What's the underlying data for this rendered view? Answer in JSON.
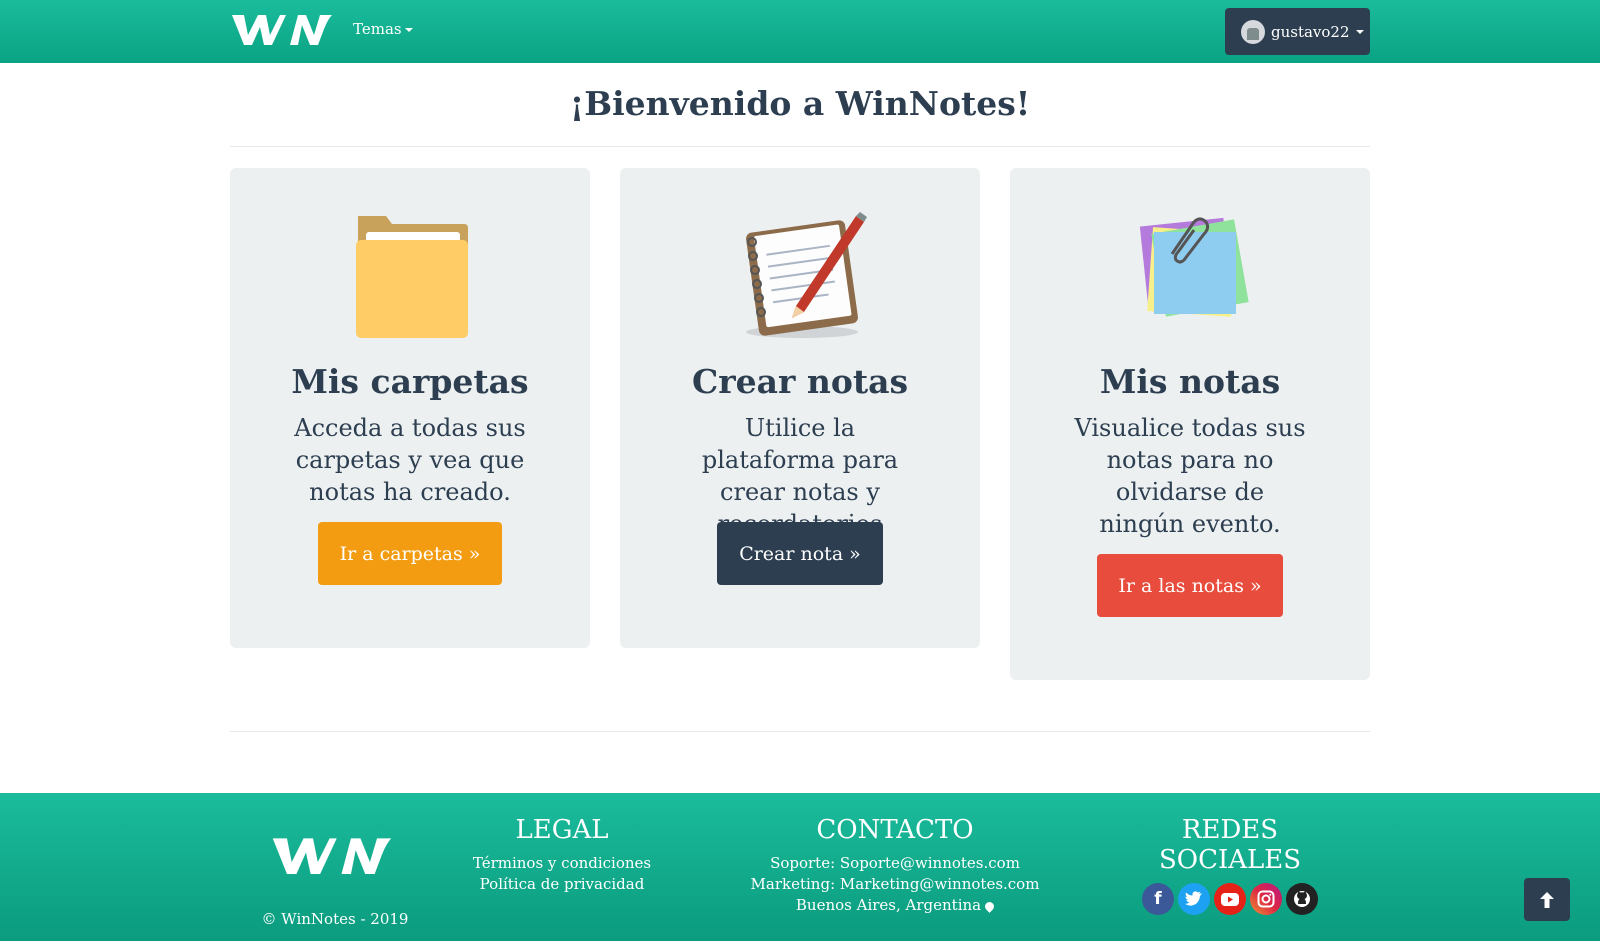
{
  "navbar": {
    "brand": "WN",
    "menu_temas": "Temas",
    "user_name": "gustavo22"
  },
  "page": {
    "title": "¡Bienvenido a WinNotes!"
  },
  "cards": [
    {
      "icon": "folder-icon",
      "title": "Mis carpetas",
      "text": "Acceda a todas sus carpetas y vea que notas ha creado.",
      "button": "Ir a carpetas »",
      "button_color": "#f39c12"
    },
    {
      "icon": "notebook-pencil-icon",
      "title": "Crear notas",
      "text": "Utilice la plataforma para crear notas y recordatorios útiles.",
      "button": "Crear nota »",
      "button_color": "#2c3e50"
    },
    {
      "icon": "sticky-notes-icon",
      "title": "Mis notas",
      "text": "Visualice todas sus notas para no olvidarse de ningún evento.",
      "button": "Ir a las notas »",
      "button_color": "#e74c3c"
    }
  ],
  "footer": {
    "logo": "WN",
    "copyright": "© WinNotes - 2019",
    "legal": {
      "heading": "LEGAL",
      "links": [
        "Términos y condiciones",
        "Política de privacidad"
      ]
    },
    "contact": {
      "heading": "CONTACTO",
      "support": "Soporte: Soporte@winnotes.com",
      "marketing": "Marketing: Marketing@winnotes.com",
      "location": "Buenos Aires, Argentina"
    },
    "social": {
      "heading": "REDES SOCIALES",
      "icons": [
        "facebook-icon",
        "twitter-icon",
        "youtube-icon",
        "instagram-icon",
        "github-icon"
      ]
    }
  },
  "colors": {
    "primary": "#1abc9c",
    "dark": "#2c3e50",
    "card_bg": "#ecf0f1"
  }
}
